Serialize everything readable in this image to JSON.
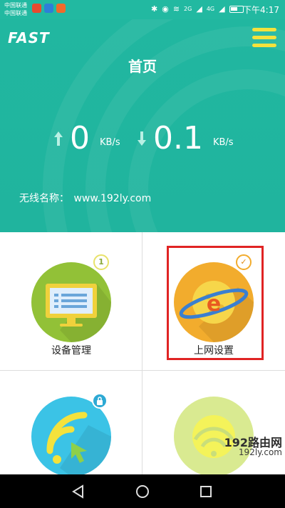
{
  "status_bar": {
    "carrier_1": "中国联通",
    "carrier_2": "中国联通",
    "network_1": "2G",
    "network_2": "4G",
    "time": "下午4:17"
  },
  "header": {
    "logo": "FAST",
    "title": "首页",
    "upload_value": "0",
    "upload_unit": "KB/s",
    "download_value": "0.1",
    "download_unit": "KB/s",
    "wifi_label": "无线名称：",
    "wifi_name": "www.192ly.com"
  },
  "tiles": [
    {
      "label": "设备管理",
      "badge": "1",
      "icon": "monitor-icon"
    },
    {
      "label": "上网设置",
      "badge": "✓",
      "icon": "internet-globe-icon"
    },
    {
      "label": "",
      "badge": "lock",
      "icon": "wifi-cursor-icon"
    },
    {
      "label": "",
      "badge": "",
      "icon": "wifi-icon"
    }
  ],
  "watermark": {
    "main": "192路由网",
    "sub": "192ly.com"
  },
  "colors": {
    "header_bg": "#21b7a0",
    "accent_yellow": "#f4e23c",
    "highlight": "#e02424"
  }
}
